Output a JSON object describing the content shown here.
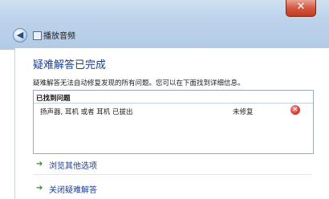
{
  "window": {
    "title": "播放音频",
    "close_glyph": "✕"
  },
  "page": {
    "heading": "疑难解答已完成",
    "description": "疑难解答无法自动修复发现的所有问题。您可以在下面找到详细信息。"
  },
  "results": {
    "header": "已找到问题",
    "items": [
      {
        "problem": "扬声器, 耳机 或者 耳机 已拔出",
        "status": "未修复",
        "status_icon": "error-icon"
      }
    ]
  },
  "options": [
    {
      "label": "浏览其他选项",
      "icon": "green-arrow-icon"
    },
    {
      "label": "关闭疑难解答",
      "icon": "green-arrow-icon"
    }
  ],
  "colors": {
    "heading": "#1e3d8f",
    "titlebar": "#bcd3ea",
    "close_button": "#c13b22",
    "error": "#d9463a",
    "arrow": "#2e8b2e"
  }
}
